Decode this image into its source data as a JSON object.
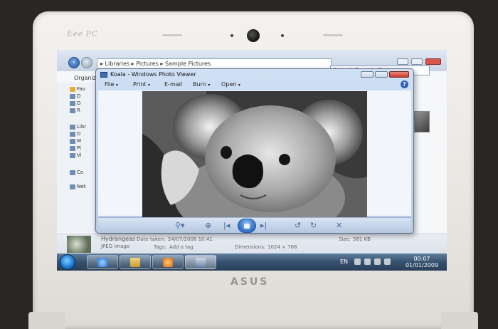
{
  "laptop": {
    "brand_top": "Eee PC",
    "brand_bottom": "ASUS"
  },
  "explorer": {
    "breadcrumb": "▸ Libraries ▸ Pictures ▸ Sample Pictures",
    "search_placeholder": "Search Sample Pictures",
    "organize_label": "Organiz",
    "sidebar": {
      "favorites": "Fav",
      "fav_items": [
        "D",
        "D",
        "R"
      ],
      "libraries": "Libr",
      "lib_items": [
        "D",
        "M",
        "Pi",
        "Vi"
      ],
      "computer": "Co",
      "network": "Net"
    },
    "details": {
      "name": "Hydrangeas",
      "date_taken_label": "Date taken:",
      "date_taken": "24/07/2008 10:41",
      "type": "JPEG image",
      "tags_label": "Tags:",
      "tags": "Add a tag",
      "dimensions_label": "Dimensions:",
      "dimensions": "1024 × 768",
      "size_label": "Size:",
      "size": "581 KB"
    }
  },
  "viewer": {
    "title": "Koala - Windows Photo Viewer",
    "menu": [
      {
        "label": "File",
        "arrow": "▾"
      },
      {
        "label": "Print",
        "arrow": "▾"
      },
      {
        "label": "E-mail",
        "arrow": ""
      },
      {
        "label": "Burn",
        "arrow": "▾"
      },
      {
        "label": "Open",
        "arrow": "▾"
      }
    ],
    "help": "?",
    "toolbar": {
      "zoom": "⚲▾",
      "fit": "⊕",
      "prev": "|◂",
      "next": "▸|",
      "rotate_ccw": "↺",
      "rotate_cw": "↻",
      "delete": "✕"
    }
  },
  "taskbar": {
    "language": "EN",
    "time": "00:07",
    "date": "01/01/2009"
  },
  "colors": {
    "start_orb": "#1f7cd3",
    "taskbar": "#36516f",
    "viewer_frame": "#b9cbe4"
  }
}
